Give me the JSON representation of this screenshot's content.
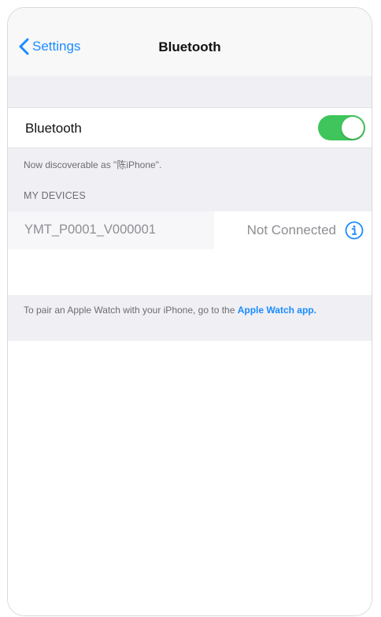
{
  "colors": {
    "accent": "#1a8cff",
    "toggle_on": "#3fc55b",
    "group_background": "#efeff4",
    "secondary_text": "#8e8e93"
  },
  "navbar": {
    "back_label": "Settings",
    "back_icon": "chevron-left-icon",
    "title": "Bluetooth"
  },
  "bluetooth_toggle": {
    "label": "Bluetooth",
    "enabled": true
  },
  "discoverable_text": "Now discoverable as \"陈iPhone\".",
  "my_devices": {
    "header": "MY DEVICES",
    "devices": [
      {
        "name": "YMT_P0001_V000001",
        "status": "Not Connected",
        "icon": "info-icon"
      }
    ]
  },
  "footer": {
    "text_before": "To pair an Apple Watch with your iPhone, go to the ",
    "link_text": "Apple Watch app",
    "text_after": "."
  }
}
